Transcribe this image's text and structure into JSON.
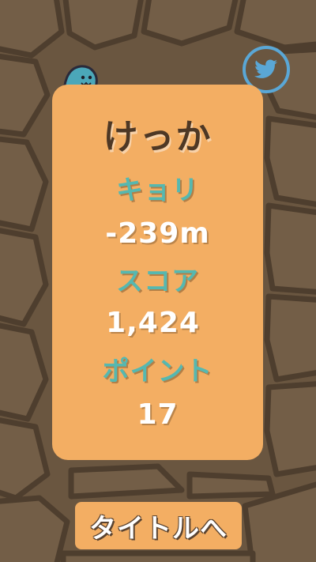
{
  "colors": {
    "background": "#6a5640",
    "card": "#f3ae63",
    "label": "#56b8b0",
    "value": "#ffffff",
    "title": "#4e3825",
    "twitter": "#5aa7d6"
  },
  "icons": {
    "twitter": "twitter-bird-icon",
    "mascot": "ghost-mascot-icon"
  },
  "result": {
    "title": "けっか",
    "distance_label": "キョリ",
    "distance_value": "-239m",
    "score_label": "スコア",
    "score_value": "1,424",
    "points_label": "ポイント",
    "points_value": "17"
  },
  "buttons": {
    "to_title": "タイトルへ"
  }
}
